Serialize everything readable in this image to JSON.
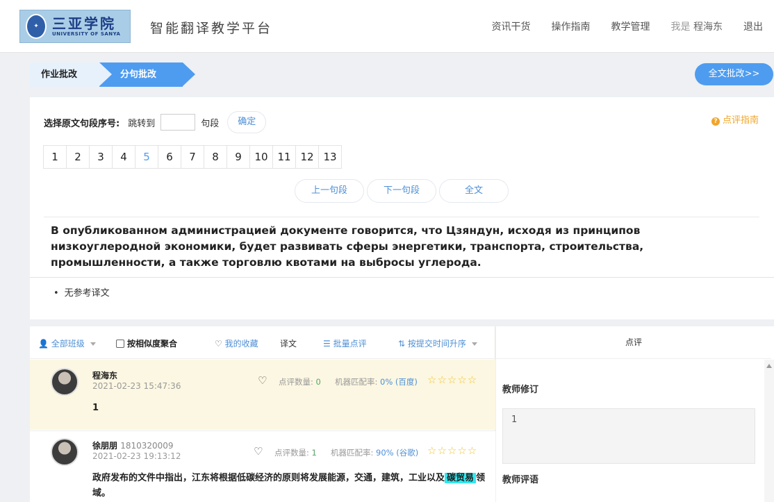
{
  "header": {
    "logo_cn": "三亚学院",
    "logo_en": "UNIVERSITY OF SANYA",
    "platform_title": "智能翻译教学平台",
    "nav": [
      "资讯干货",
      "操作指南",
      "教学管理"
    ],
    "me_label": "我是",
    "me_name": "程海东",
    "logout": "退出"
  },
  "steps": {
    "step1": "作业批改",
    "step2": "分句批改",
    "full_review": "全文批改>>"
  },
  "selector": {
    "label": "选择原文句段序号:",
    "jump_to": "跳转到",
    "segment_suffix": "句段",
    "confirm": "确定",
    "guide": "点评指南",
    "pages": [
      "1",
      "2",
      "3",
      "4",
      "5",
      "6",
      "7",
      "8",
      "9",
      "10",
      "11",
      "12",
      "13"
    ],
    "active_page": "5",
    "prev": "上一句段",
    "next": "下一句段",
    "full_text": "全文"
  },
  "source_text": "В опубликованном администрацией документе говорится, что Цзяндун, исходя из принципов низкоуглеродной экономики, будет развивать сферы энергетики, транспорта, строительства, промышленности, а также торговлю квотами на выбросы углерода.",
  "reference": "无参考译文",
  "toolbar": {
    "all_classes": "全部班级",
    "aggregate": "按相似度聚合",
    "favorites": "我的收藏",
    "translation": "译文",
    "batch": "批量点评",
    "sort": "按提交时间升序"
  },
  "submissions": [
    {
      "name": "程海东",
      "student_id": "",
      "time": "2021-02-23 15:47:36",
      "review_count_label": "点评数量:",
      "review_count": "0",
      "match_label": "机器匹配率:",
      "match_value": "0% (百度)",
      "content": "1"
    },
    {
      "name": "徐朋朋",
      "student_id": "1810320009",
      "time": "2021-02-23 19:13:12",
      "review_count_label": "点评数量:",
      "review_count": "1",
      "match_label": "机器匹配率:",
      "match_value": "90% (谷歌)",
      "content_pre": "政府发布的文件中指出，江东将根据低碳经济的原则将发展能源，交通，建筑，工业以及",
      "content_highlight": "碳贸易",
      "content_post": "领域。"
    }
  ],
  "review_panel": {
    "title": "点评",
    "teacher_revision": "教师修订",
    "revision_value": "1",
    "teacher_comment": "教师评语"
  },
  "colors": {
    "accent": "#4e9cf0",
    "highlight_row": "#fcf7e2",
    "star": "#f2c430",
    "guide": "#f0a52a",
    "highlight_text": "#2ee9f0"
  }
}
